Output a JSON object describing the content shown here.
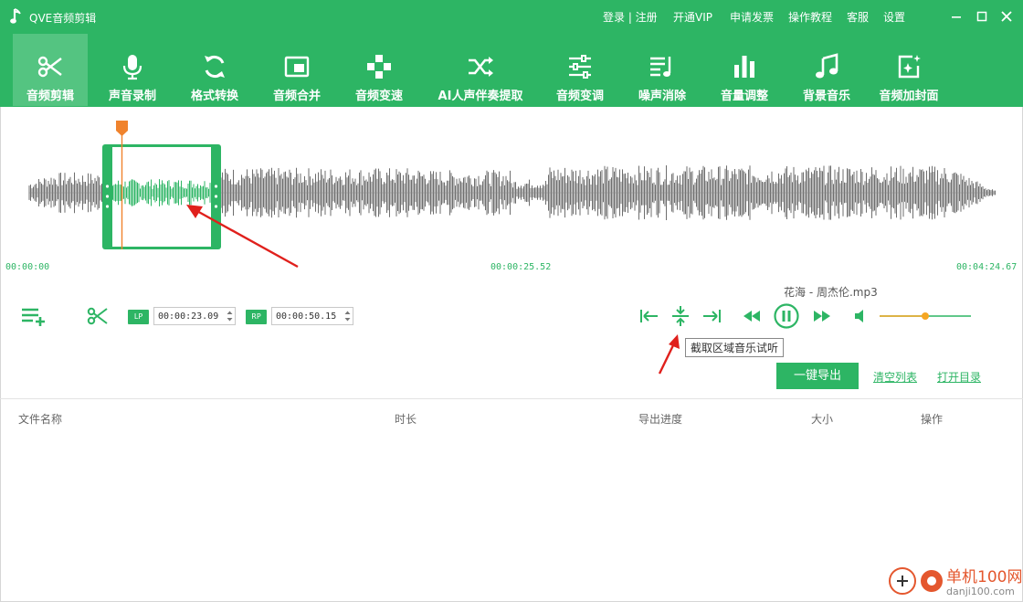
{
  "app": {
    "title": "QVE音频剪辑",
    "top_links": [
      "登录 | 注册",
      "开通VIP",
      "申请发票",
      "操作教程",
      "客服",
      "设置"
    ]
  },
  "toolbar": {
    "items": [
      {
        "label": "音频剪辑",
        "icon": "scissors-icon",
        "active": true
      },
      {
        "label": "声音录制",
        "icon": "microphone-icon"
      },
      {
        "label": "格式转换",
        "icon": "refresh-icon"
      },
      {
        "label": "音频合并",
        "icon": "merge-icon"
      },
      {
        "label": "音频变速",
        "icon": "speed-icon"
      },
      {
        "label": "AI人声伴奏提取",
        "icon": "shuffle-icon"
      },
      {
        "label": "音频变调",
        "icon": "sliders-icon"
      },
      {
        "label": "噪声消除",
        "icon": "noise-icon"
      },
      {
        "label": "音量调整",
        "icon": "bar-chart-icon"
      },
      {
        "label": "背景音乐",
        "icon": "music-note-icon"
      },
      {
        "label": "音频加封面",
        "icon": "image-sparkle-icon"
      }
    ]
  },
  "waveform": {
    "time_start": "00:00:00",
    "time_mid": "00:00:25.52",
    "time_end": "00:04:24.67",
    "colors": {
      "wave": "#6e6e6e",
      "selection": "#2db564",
      "playhead": "#f0832d"
    }
  },
  "controls": {
    "lp_label": "LP",
    "rp_label": "RP",
    "lp_value": "00:00:23.09",
    "rp_value": "00:00:50.15",
    "now_playing": "花海 - 周杰伦.mp3",
    "tooltip": "截取区域音乐试听",
    "volume_level": 0.5
  },
  "actions": {
    "export": "一键导出",
    "clear": "清空列表",
    "open_dir": "打开目录"
  },
  "table": {
    "columns": [
      "文件名称",
      "时长",
      "导出进度",
      "大小",
      "操作"
    ]
  },
  "watermark": {
    "line1": "单机100网",
    "line2": "danji100.com"
  }
}
